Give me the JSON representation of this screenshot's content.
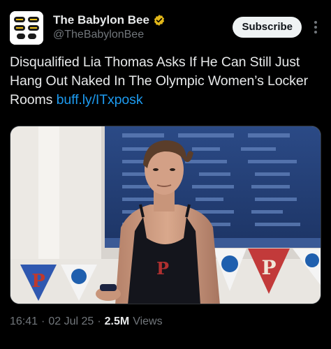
{
  "account": {
    "display_name": "The Babylon Bee",
    "handle": "@TheBabylonBee",
    "verified_color": "#e2b719",
    "avatar_icon": "bee-logo-icon"
  },
  "actions": {
    "subscribe_label": "Subscribe",
    "more_icon": "more-vertical-icon"
  },
  "post": {
    "text": "Disqualified Lia Thomas Asks If He Can Still Just Hang Out Naked In The Olympic Women’s Locker Rooms",
    "link": "buff.ly/ITxposk"
  },
  "media": {
    "description_icon": "photo",
    "banner_letter": "P"
  },
  "meta": {
    "time": "16:41",
    "date": "02 Jul 25",
    "views_count": "2.5M",
    "views_label": "Views",
    "separator": "·"
  },
  "colors": {
    "background": "#000000",
    "link": "#1d9bf0",
    "secondary_text": "#71767b"
  }
}
